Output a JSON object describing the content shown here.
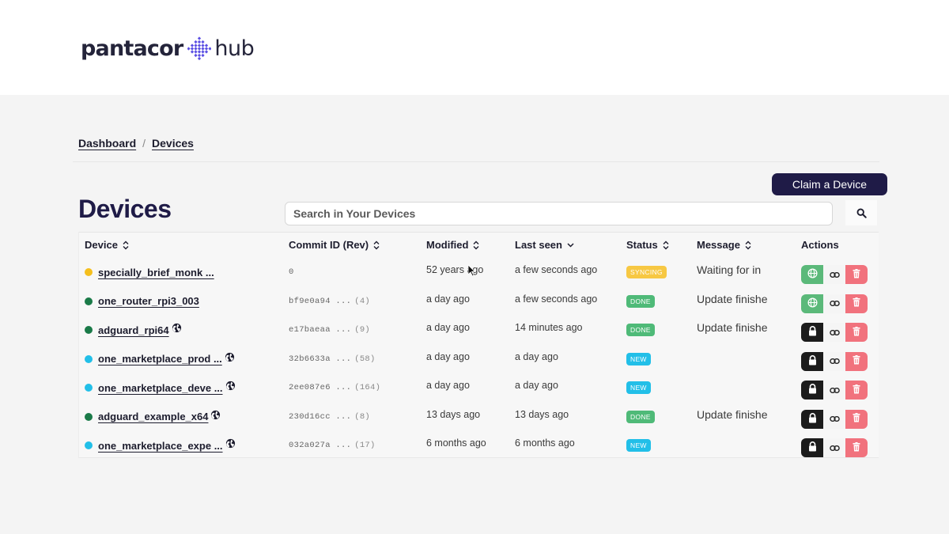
{
  "brand": {
    "name": "pantacor",
    "suffix": "hub",
    "accent_color": "#5b4fe3"
  },
  "breadcrumb": {
    "items": [
      "Dashboard",
      "Devices"
    ],
    "separator": "/"
  },
  "page": {
    "title": "Devices",
    "claim_button": "Claim a Device",
    "search_placeholder": "Search in Your Devices",
    "search_icon": "search-icon"
  },
  "table": {
    "headers": {
      "device": "Device",
      "commit": "Commit ID (Rev)",
      "modified": "Modified",
      "last_seen": "Last seen",
      "status": "Status",
      "message": "Message",
      "actions": "Actions"
    },
    "rows": [
      {
        "dot_color": "#f5bf1d",
        "name": "specially_brief_monk ...",
        "public": false,
        "commit": "0",
        "rev": "",
        "modified": "52 years ago",
        "last_seen": "a few seconds ago",
        "status": "SYNCING",
        "status_color": "#f7c843",
        "message": "Waiting for in",
        "visibility_icon": "globe-icon",
        "visibility_color": "#5bb97a"
      },
      {
        "dot_color": "#1a7a48",
        "name": "one_router_rpi3_003",
        "public": false,
        "commit": "bf9e0a94 ...",
        "rev": "(4)",
        "modified": "a day ago",
        "last_seen": "a few seconds ago",
        "status": "DONE",
        "status_color": "#4fba78",
        "message": "Update finishe",
        "visibility_icon": "globe-icon",
        "visibility_color": "#5bb97a"
      },
      {
        "dot_color": "#1a7a48",
        "name": "adguard_rpi64",
        "public": true,
        "commit": "e17baeaa ...",
        "rev": "(9)",
        "modified": "a day ago",
        "last_seen": "14 minutes ago",
        "status": "DONE",
        "status_color": "#4fba78",
        "message": "Update finishe",
        "visibility_icon": "lock-icon",
        "visibility_color": "#1c1c1c"
      },
      {
        "dot_color": "#22bfe8",
        "name": "one_marketplace_prod ...",
        "public": true,
        "commit": "32b6633a ...",
        "rev": "(58)",
        "modified": "a day ago",
        "last_seen": "a day ago",
        "status": "NEW",
        "status_color": "#22bfe8",
        "message": "",
        "visibility_icon": "lock-icon",
        "visibility_color": "#1c1c1c"
      },
      {
        "dot_color": "#22bfe8",
        "name": "one_marketplace_deve ...",
        "public": true,
        "commit": "2ee087e6 ...",
        "rev": "(164)",
        "modified": "a day ago",
        "last_seen": "a day ago",
        "status": "NEW",
        "status_color": "#22bfe8",
        "message": "",
        "visibility_icon": "lock-icon",
        "visibility_color": "#1c1c1c"
      },
      {
        "dot_color": "#1a7a48",
        "name": "adguard_example_x64",
        "public": true,
        "commit": "230d16cc ...",
        "rev": "(8)",
        "modified": "13 days ago",
        "last_seen": "13 days ago",
        "status": "DONE",
        "status_color": "#4fba78",
        "message": "Update finishe",
        "visibility_icon": "lock-icon",
        "visibility_color": "#1c1c1c"
      },
      {
        "dot_color": "#22bfe8",
        "name": "one_marketplace_expe ...",
        "public": true,
        "commit": "032a027a ...",
        "rev": "(17)",
        "modified": "6 months ago",
        "last_seen": "6 months ago",
        "status": "NEW",
        "status_color": "#22bfe8",
        "message": "",
        "visibility_icon": "lock-icon",
        "visibility_color": "#1c1c1c"
      }
    ]
  }
}
